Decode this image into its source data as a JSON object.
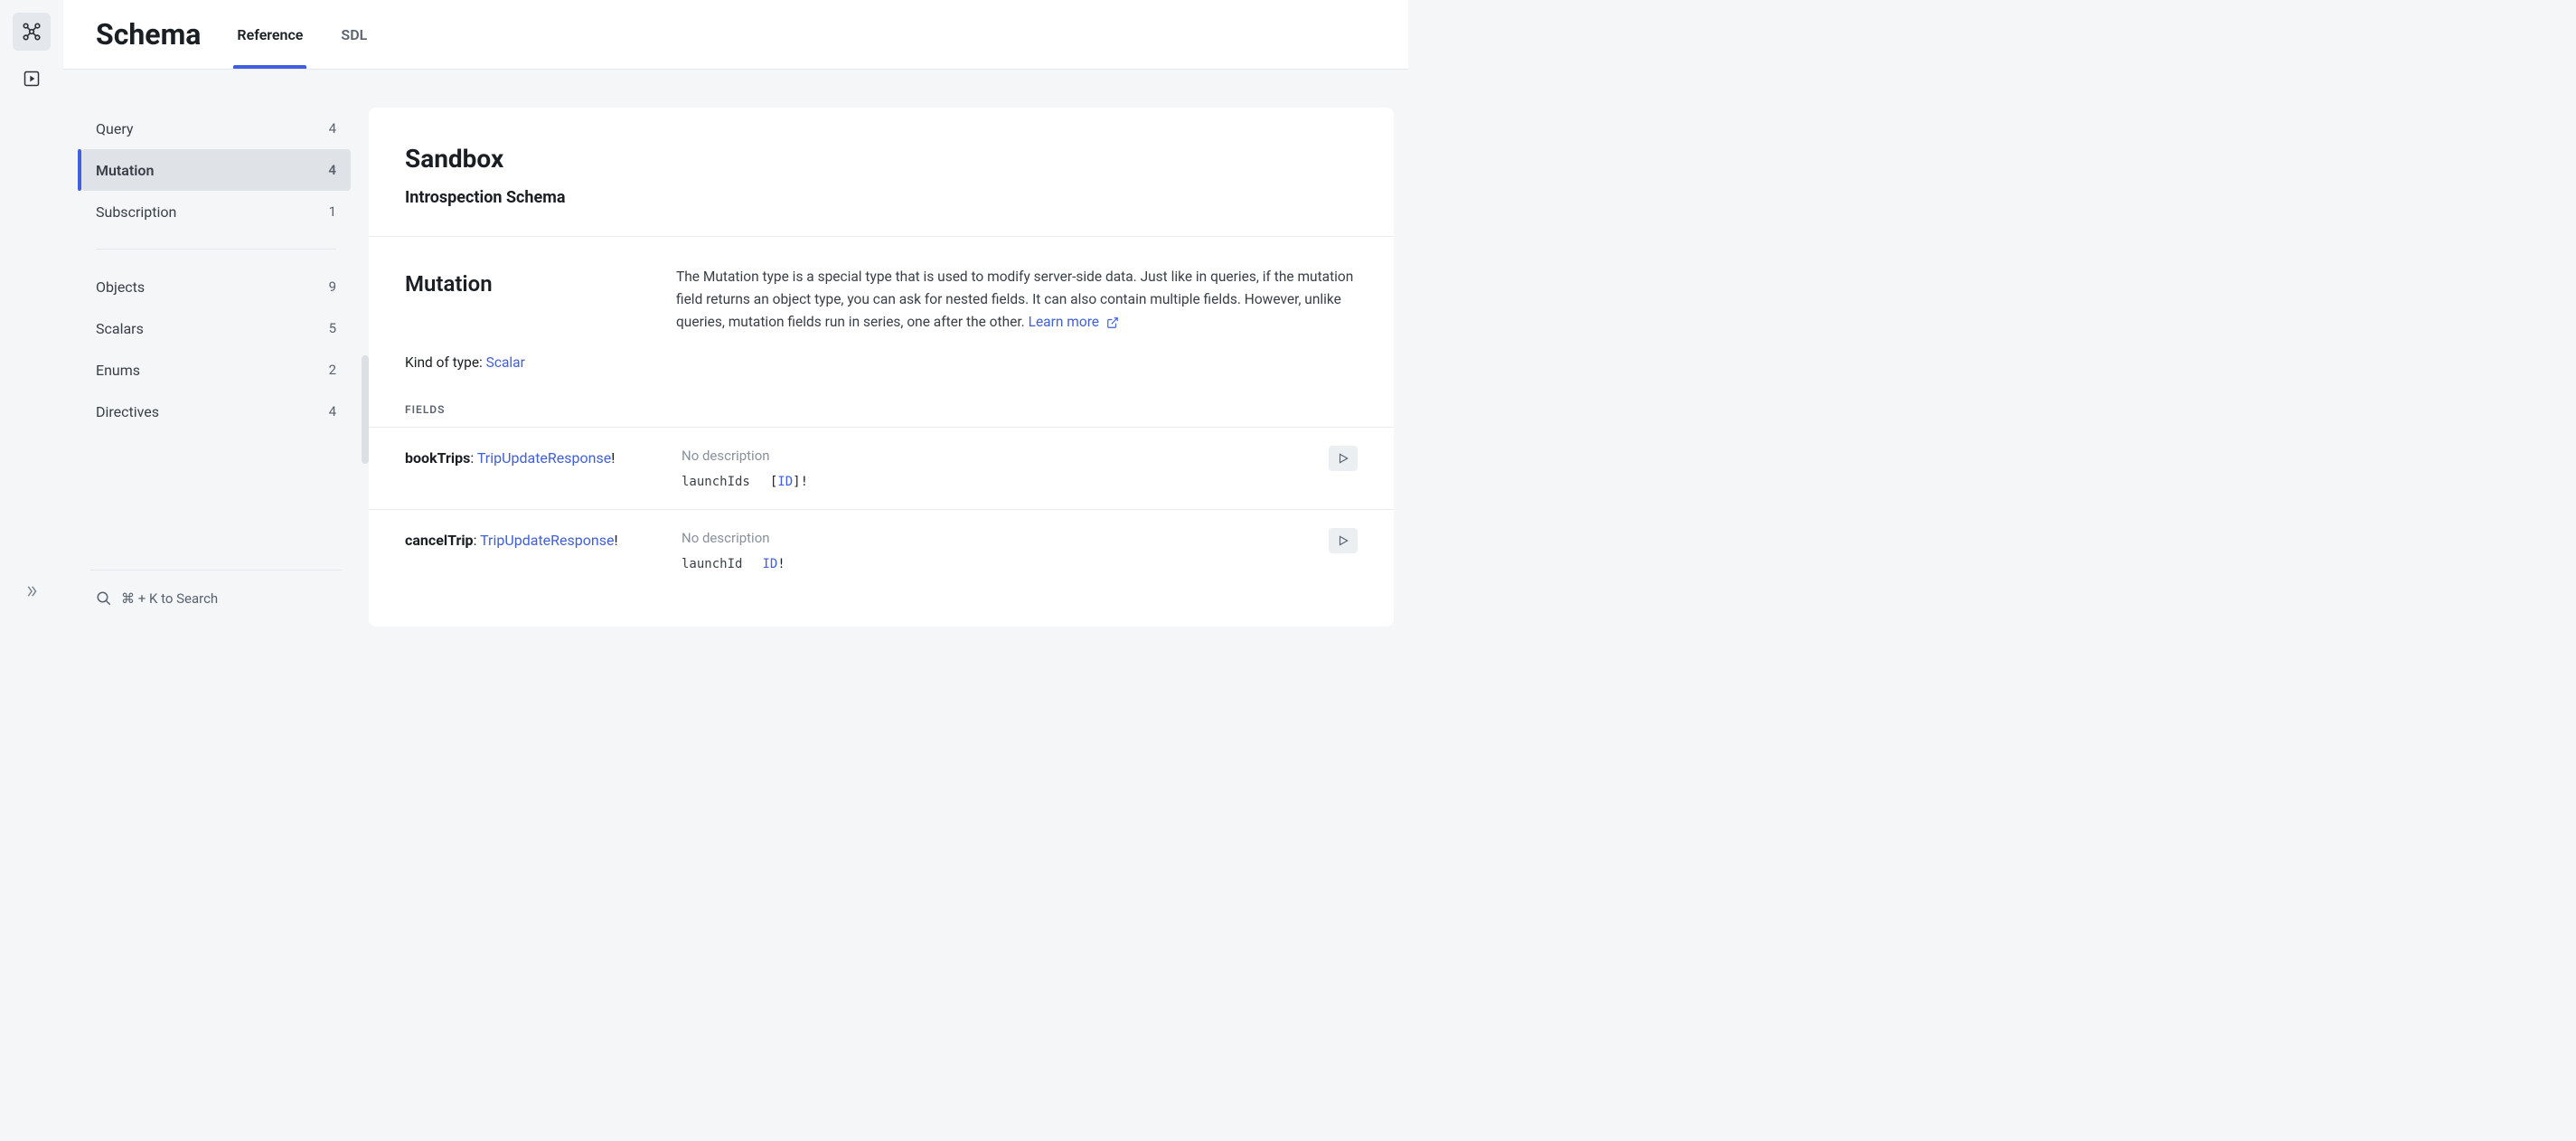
{
  "page_title": "Schema",
  "tabs": [
    {
      "label": "Reference",
      "active": true
    },
    {
      "label": "SDL",
      "active": false
    }
  ],
  "sidebar": {
    "items": [
      {
        "label": "Query",
        "count": "4",
        "selected": false
      },
      {
        "label": "Mutation",
        "count": "4",
        "selected": true
      },
      {
        "label": "Subscription",
        "count": "1",
        "selected": false
      },
      {
        "divider": true
      },
      {
        "label": "Objects",
        "count": "9",
        "selected": false
      },
      {
        "label": "Scalars",
        "count": "5",
        "selected": false
      },
      {
        "label": "Enums",
        "count": "2",
        "selected": false
      },
      {
        "label": "Directives",
        "count": "4",
        "selected": false
      }
    ],
    "search_placeholder": "⌘ + K to Search"
  },
  "content": {
    "title": "Sandbox",
    "subtitle": "Introspection Schema",
    "type_name": "Mutation",
    "type_description": "The Mutation type is a special type that is used to modify server-side data. Just like in queries, if the mutation field returns an object type, you can ask for nested fields. It can also contain multiple fields. However, unlike queries, mutation fields run in series, one after the other.",
    "learn_more_label": "Learn more",
    "kind_label": "Kind of type:",
    "kind_value": "Scalar",
    "fields_heading": "FIELDS",
    "fields": [
      {
        "name": "bookTrips",
        "return_type": "TripUpdateResponse",
        "non_null": "!",
        "description": "No description",
        "arg_name": "launchIds",
        "arg_type_prefix": "[",
        "arg_type_link": "ID",
        "arg_type_suffix": "]!"
      },
      {
        "name": "cancelTrip",
        "return_type": "TripUpdateResponse",
        "non_null": "!",
        "description": "No description",
        "arg_name": "launchId",
        "arg_type_prefix": "",
        "arg_type_link": "ID",
        "arg_type_suffix": "!"
      }
    ]
  }
}
